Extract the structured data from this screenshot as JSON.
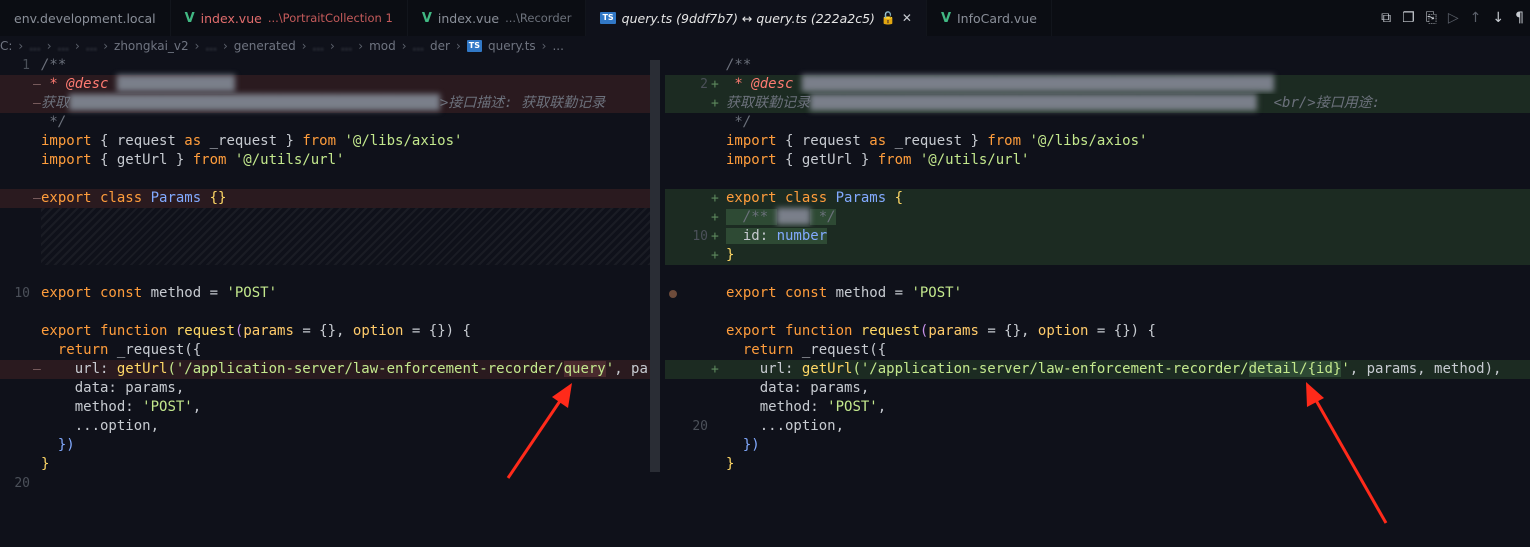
{
  "tabs": [
    {
      "name": "env.development.local",
      "sub": "",
      "icon": "file-icon",
      "state": "normal"
    },
    {
      "name": "index.vue",
      "sub": "...\\PortraitCollection 1",
      "icon": "vue-icon",
      "state": "modified"
    },
    {
      "name": "index.vue",
      "sub": "...\\Recorder",
      "icon": "vue-icon",
      "state": "normal"
    },
    {
      "name": "query.ts (9ddf7b7) ↔ query.ts (222a2c5)",
      "sub": "",
      "icon": "ts-icon",
      "state": "active"
    },
    {
      "name": "InfoCard.vue",
      "sub": "",
      "icon": "vue-icon",
      "state": "normal"
    }
  ],
  "icons": {
    "vue": "V",
    "ts": "TS",
    "lock": "🔓",
    "close": "✕",
    "toolbar": [
      "⧉",
      "❐",
      "⎘",
      "▷",
      "↑",
      "↓",
      "¶"
    ]
  },
  "breadcrumb": {
    "items": [
      "C:",
      "...",
      "...",
      "...",
      "zhongkai_v2",
      "...",
      "generated",
      "...",
      "...",
      "mod",
      "...",
      "der"
    ],
    "file": "query.ts",
    "tail": "..."
  },
  "left": {
    "line_numbers": {
      "l1": "1",
      "l10": "10",
      "l20": "20"
    },
    "code": {
      "c1": "/**",
      "c2_tag": " * @desc",
      "c3_head": "获取",
      "c3_tail": ">接口描述: 获取联勤记录",
      "c4": " */",
      "c5_kw": "import",
      "c5_mid": " { request ",
      "c5_as": "as",
      "c5_rest": " _request } ",
      "c5_from": "from",
      "c5_str": " '@/libs/axios'",
      "c6_kw": "import",
      "c6_mid": " { getUrl } ",
      "c6_from": "from",
      "c6_str": " '@/utils/url'",
      "c8_kw": "export class",
      "c8_cls": " Params",
      "c8_rest": " {}",
      "c11_kw": "export const",
      "c11_rest": " method = ",
      "c11_str": "'POST'",
      "c13_kw": "export function",
      "c13_fn": " request",
      "c13_rest1": "(",
      "c13_par1": "params",
      "c13_rest2": " = {}, ",
      "c13_par2": "option",
      "c13_rest3": " = {}) {",
      "c14_kw": "  return",
      "c14_rest": " _request({",
      "c15_prop": "    url: ",
      "c15_fn": "getUrl",
      "c15_str1": "('/application-server/law-enforcement-recorder/",
      "c15_hl": "query",
      "c15_str2": "'",
      "c15_tail": ", pa",
      "c16": "    data: params,",
      "c17_prop": "    method: ",
      "c17_str": "'POST'",
      "c17_tail": ",",
      "c18": "    ...option,",
      "c19": "  })",
      "c20": "}"
    }
  },
  "right": {
    "line_numbers": {
      "l2": "2",
      "l10": "10",
      "l20": "20"
    },
    "code": {
      "c1": "/**",
      "c2_tag": " * @desc",
      "c3_head": "获取联勤记录",
      "c3_tail": "<br/>接口用途:",
      "c4": " */",
      "c5_kw": "import",
      "c5_mid": " { request ",
      "c5_as": "as",
      "c5_rest": " _request } ",
      "c5_from": "from",
      "c5_str": " '@/libs/axios'",
      "c6_kw": "import",
      "c6_mid": " { getUrl } ",
      "c6_from": "from",
      "c6_str": " '@/utils/url'",
      "c8_kw": "export class",
      "c8_cls": " Params",
      "c8_rest": " {",
      "c9": "  /** ",
      "c9_end": " */",
      "c10_prop": "  id: ",
      "c10_type": "number",
      "c11": "}",
      "c13_kw": "export const",
      "c13_rest": " method = ",
      "c13_str": "'POST'",
      "c15_kw": "export function",
      "c15_fn": " request",
      "c15_rest1": "(",
      "c15_par1": "params",
      "c15_rest2": " = {}, ",
      "c15_par2": "option",
      "c15_rest3": " = {}) {",
      "c16_kw": "  return",
      "c16_rest": " _request({",
      "c17_prop": "    url: ",
      "c17_fn": "getUrl",
      "c17_str1": "('/application-server/law-enforcement-recorder/",
      "c17_hl": "detail/{id}",
      "c17_str2": "'",
      "c17_tail": ", params, method),",
      "c18": "    data: params,",
      "c19_prop": "    method: ",
      "c19_str": "'POST'",
      "c19_tail": ",",
      "c20": "    ...option,",
      "c21": "  })",
      "c22": "}"
    }
  },
  "markers": {
    "del": "—",
    "ins": "+"
  },
  "colors": {
    "arrow": "#ff2a1a",
    "deleted_bg": "#2a1a1f",
    "inserted_bg": "#1c2b22"
  }
}
